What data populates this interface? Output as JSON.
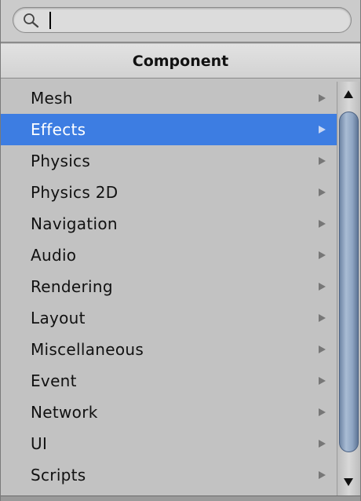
{
  "search": {
    "value": "",
    "placeholder": ""
  },
  "header": {
    "title": "Component"
  },
  "menu": {
    "selected_index": 1,
    "items": [
      {
        "label": "Mesh",
        "has_submenu": true
      },
      {
        "label": "Effects",
        "has_submenu": true
      },
      {
        "label": "Physics",
        "has_submenu": true
      },
      {
        "label": "Physics 2D",
        "has_submenu": true
      },
      {
        "label": "Navigation",
        "has_submenu": true
      },
      {
        "label": "Audio",
        "has_submenu": true
      },
      {
        "label": "Rendering",
        "has_submenu": true
      },
      {
        "label": "Layout",
        "has_submenu": true
      },
      {
        "label": "Miscellaneous",
        "has_submenu": true
      },
      {
        "label": "Event",
        "has_submenu": true
      },
      {
        "label": "Network",
        "has_submenu": true
      },
      {
        "label": "UI",
        "has_submenu": true
      },
      {
        "label": "Scripts",
        "has_submenu": true
      }
    ]
  },
  "colors": {
    "selection": "#3d7de2",
    "background": "#c2c2c2",
    "scroll_thumb": "#8ea4c2"
  },
  "icons": {
    "search": "search-icon",
    "submenu": "chevron-right-icon",
    "scroll_up": "arrow-up-icon",
    "scroll_down": "arrow-down-icon"
  }
}
